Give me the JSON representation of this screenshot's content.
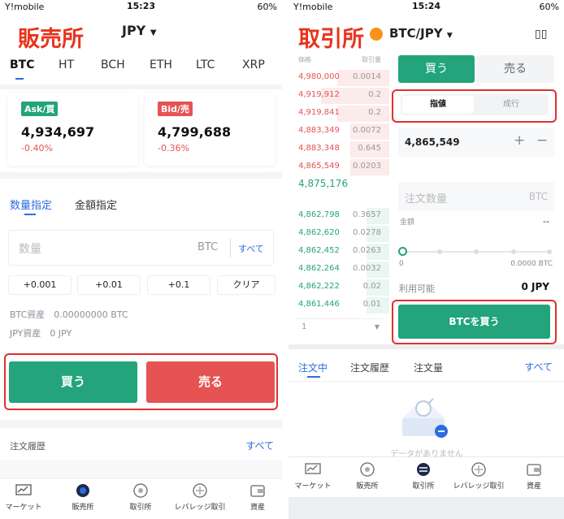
{
  "status_left": {
    "carrier": "Y!mobile",
    "time": "15:23",
    "battery": "60%"
  },
  "status_right": {
    "carrier": "Y!mobile",
    "time": "15:24",
    "battery": "60%"
  },
  "left": {
    "annotation": "販売所",
    "currency": "JPY",
    "tabs": [
      "BTC",
      "HT",
      "BCH",
      "ETH",
      "LTC",
      "XRP"
    ],
    "ask": {
      "badge": "Ask/買",
      "price": "4,934,697",
      "change": "-0.40%"
    },
    "bid": {
      "badge": "Bid/売",
      "price": "4,799,688",
      "change": "-0.36%"
    },
    "mode_tabs": [
      "数量指定",
      "金額指定"
    ],
    "qty_placeholder": "数量",
    "qty_unit": "BTC",
    "qty_all": "すべて",
    "quick": [
      "+0.001",
      "+0.01",
      "+0.1",
      "クリア"
    ],
    "btc_asset": "BTC資産　0.00000000 BTC",
    "jpy_asset": "JPY資産　0 JPY",
    "buy": "買う",
    "sell": "売る",
    "history": "注文履歴",
    "history_all": "すべて",
    "nav": [
      "マーケット",
      "販売所",
      "取引所",
      "レバレッジ取引",
      "資産"
    ]
  },
  "right": {
    "annotation": "取引所",
    "pair": "BTC/JPY",
    "book_head": {
      "price": "価格",
      "amount": "取引量"
    },
    "asks": [
      {
        "p": "4,980,000",
        "a": "0.0014"
      },
      {
        "p": "4,919,912",
        "a": "0.2"
      },
      {
        "p": "4,919,841",
        "a": "0.2"
      },
      {
        "p": "4,883,349",
        "a": "0.0072"
      },
      {
        "p": "4,883,348",
        "a": "0.645"
      },
      {
        "p": "4,865,549",
        "a": "0.0203"
      }
    ],
    "mid": "4,875,176",
    "bids": [
      {
        "p": "4,862,798",
        "a": "0.3657"
      },
      {
        "p": "4,862,620",
        "a": "0.0278"
      },
      {
        "p": "4,862,452",
        "a": "0.0263"
      },
      {
        "p": "4,862,264",
        "a": "0.0032"
      },
      {
        "p": "4,862,222",
        "a": "0.02"
      },
      {
        "p": "4,861,446",
        "a": "0.01"
      }
    ],
    "depth": "1",
    "buy_tab": "買う",
    "sell_tab": "売る",
    "type_tabs": [
      "指値",
      "成行"
    ],
    "price_value": "4,865,549",
    "qty_placeholder": "注文数量",
    "qty_unit": "BTC",
    "amount_label": "金額",
    "amount_value": "--",
    "slider_min": "0",
    "slider_max": "0.0000 BTC",
    "available_label": "利用可能",
    "available_value": "0 JPY",
    "buy_btn": "BTCを買う",
    "order_tabs": [
      "注文中",
      "注文履歴",
      "注文量"
    ],
    "order_all": "すべて",
    "empty_text": "データがありません",
    "nav": [
      "マーケット",
      "販売所",
      "取引所",
      "レバレッジ取引",
      "資産"
    ]
  },
  "colors": {
    "green": "#23a47b",
    "red": "#e55353",
    "blue": "#2d6cdf",
    "annotation": "#e8331c"
  }
}
